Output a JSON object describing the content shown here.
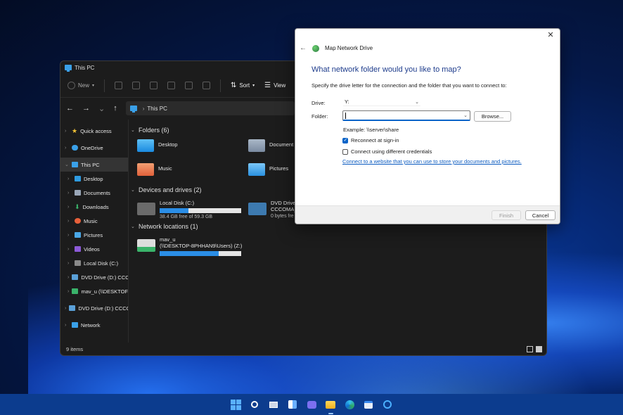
{
  "explorer": {
    "title": "This PC",
    "toolbar": {
      "new_label": "New",
      "sort_label": "Sort",
      "view_label": "View"
    },
    "breadcrumb": "This PC",
    "sidebar": [
      {
        "label": "Quick access"
      },
      {
        "label": "OneDrive"
      },
      {
        "label": "This PC"
      },
      {
        "label": "Desktop"
      },
      {
        "label": "Documents"
      },
      {
        "label": "Downloads"
      },
      {
        "label": "Music"
      },
      {
        "label": "Pictures"
      },
      {
        "label": "Videos"
      },
      {
        "label": "Local Disk (C:)"
      },
      {
        "label": "DVD Drive (D:) CCCO"
      },
      {
        "label": "mav_u (\\\\DESKTOF"
      },
      {
        "label": "DVD Drive (D:) CCCO"
      },
      {
        "label": "Network"
      }
    ],
    "folders_header": "Folders (6)",
    "folders": [
      {
        "label": "Desktop"
      },
      {
        "label": "Document"
      },
      {
        "label": "Music"
      },
      {
        "label": "Pictures"
      }
    ],
    "drives_header": "Devices and drives (2)",
    "drives": [
      {
        "label": "Local Disk (C:)",
        "free": "38.4 GB free of 59.3 GB",
        "used_fraction": 0.35
      },
      {
        "label": "DVD Drive",
        "label2": "CCCOMA_",
        "free": "0 bytes fre"
      }
    ],
    "network_header": "Network locations (1)",
    "network": [
      {
        "label": "mav_u",
        "label2": "(\\\\DESKTOP-8PHHAN9\\Users) (Z:)",
        "used_fraction": 0.72
      }
    ],
    "status": "9 items"
  },
  "dialog": {
    "title": "Map Network Drive",
    "heading": "What network folder would you like to map?",
    "description": "Specify the drive letter for the connection and the folder that you want to connect to:",
    "drive_label": "Drive:",
    "drive_value": "Y:",
    "folder_label": "Folder:",
    "folder_value": "",
    "browse_label": "Browse...",
    "example": "Example: \\\\server\\share",
    "reconnect_label": "Reconnect at sign-in",
    "reconnect_checked": true,
    "credentials_label": "Connect using different credentials",
    "credentials_checked": false,
    "link_text": "Connect to a website that you can use to store your documents and pictures.",
    "finish_label": "Finish",
    "cancel_label": "Cancel"
  },
  "taskbar": {
    "icons": [
      "start-icon",
      "search-icon",
      "task-view-icon",
      "widgets-icon",
      "teams-chat-icon",
      "file-explorer-icon",
      "edge-icon",
      "store-icon",
      "cortana-icon"
    ]
  }
}
